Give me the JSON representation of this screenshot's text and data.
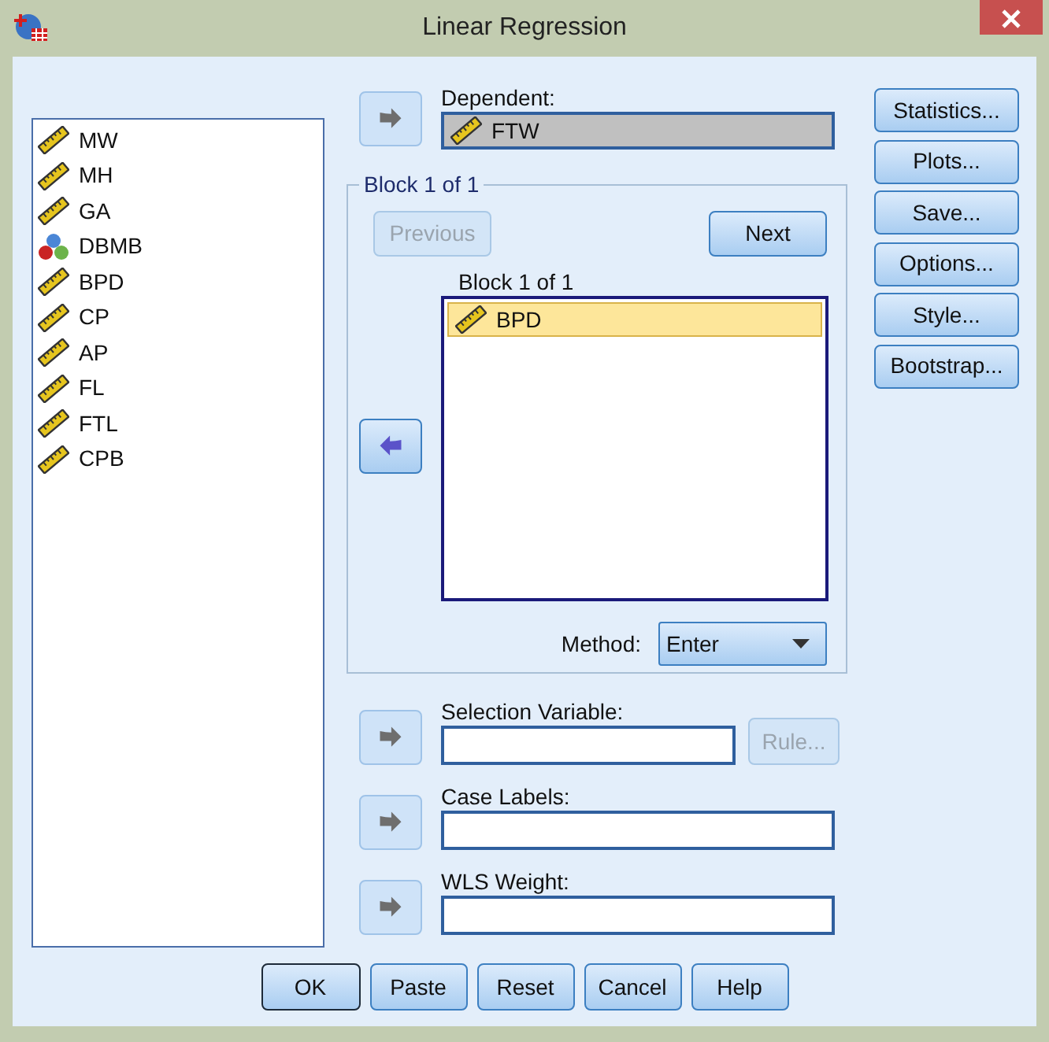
{
  "window": {
    "title": "Linear Regression"
  },
  "variables": [
    {
      "name": "MW",
      "kind": "scale",
      "selected": false
    },
    {
      "name": "MH",
      "kind": "scale",
      "selected": false
    },
    {
      "name": "GA",
      "kind": "scale",
      "selected": false
    },
    {
      "name": "DBMB",
      "kind": "nominal",
      "selected": false
    },
    {
      "name": "BPD",
      "kind": "scale",
      "selected": false
    },
    {
      "name": "CP",
      "kind": "scale",
      "selected": false
    },
    {
      "name": "AP",
      "kind": "scale",
      "selected": false
    },
    {
      "name": "FL",
      "kind": "scale",
      "selected": false
    },
    {
      "name": "FTL",
      "kind": "scale",
      "selected": false
    },
    {
      "name": "CPB",
      "kind": "scale",
      "selected": false
    }
  ],
  "dependent": {
    "label": "Dependent:",
    "arrow": {
      "kind": "right",
      "active": false
    },
    "value": {
      "name": "FTW",
      "kind": "scale"
    }
  },
  "block": {
    "title": "Block 1 of 1",
    "previous": {
      "label": "Previous",
      "disabled": true
    },
    "next": {
      "label": "Next",
      "disabled": false
    },
    "list_label": "Block 1 of 1",
    "arrow": {
      "kind": "left",
      "active": true
    },
    "independents": [
      {
        "name": "BPD",
        "kind": "scale",
        "selected": true
      }
    ],
    "method": {
      "label": "Method:",
      "value": "Enter"
    }
  },
  "fields": [
    {
      "label": "Selection Variable:",
      "arrow": {
        "kind": "right",
        "active": false
      },
      "rule": {
        "label": "Rule...",
        "disabled": true
      }
    },
    {
      "label": "Case Labels:",
      "arrow": {
        "kind": "right",
        "active": false
      }
    },
    {
      "label": "WLS Weight:",
      "arrow": {
        "kind": "right",
        "active": false
      }
    }
  ],
  "side_buttons": [
    "Statistics...",
    "Plots...",
    "Save...",
    "Options...",
    "Style...",
    "Bootstrap..."
  ],
  "buttons": [
    {
      "label": "OK",
      "default": true
    },
    {
      "label": "Paste",
      "default": false
    },
    {
      "label": "Reset",
      "default": false
    },
    {
      "label": "Cancel",
      "default": false
    },
    {
      "label": "Help",
      "default": false
    }
  ]
}
